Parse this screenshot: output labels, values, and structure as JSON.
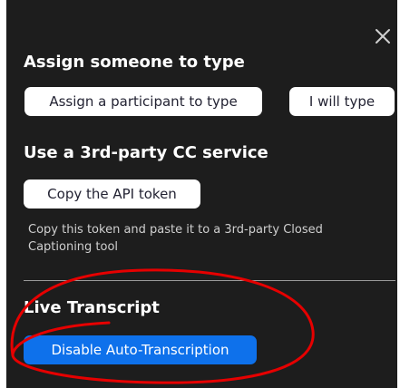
{
  "panel": {
    "close_icon": "close-icon",
    "colors": {
      "background": "#1d1d1d",
      "primary_button": "#0e71eb",
      "annotation": "#e60000"
    }
  },
  "assign_section": {
    "title": "Assign someone to type",
    "assign_participant_label": "Assign a participant to type",
    "i_will_type_label": "I will type"
  },
  "cc_section": {
    "title": "Use a 3rd-party CC service",
    "copy_token_label": "Copy the API token",
    "helper_text": "Copy this token and paste it to a 3rd-party Closed Captioning tool"
  },
  "live_section": {
    "title": "Live Transcript",
    "disable_auto_label": "Disable Auto-Transcription"
  }
}
